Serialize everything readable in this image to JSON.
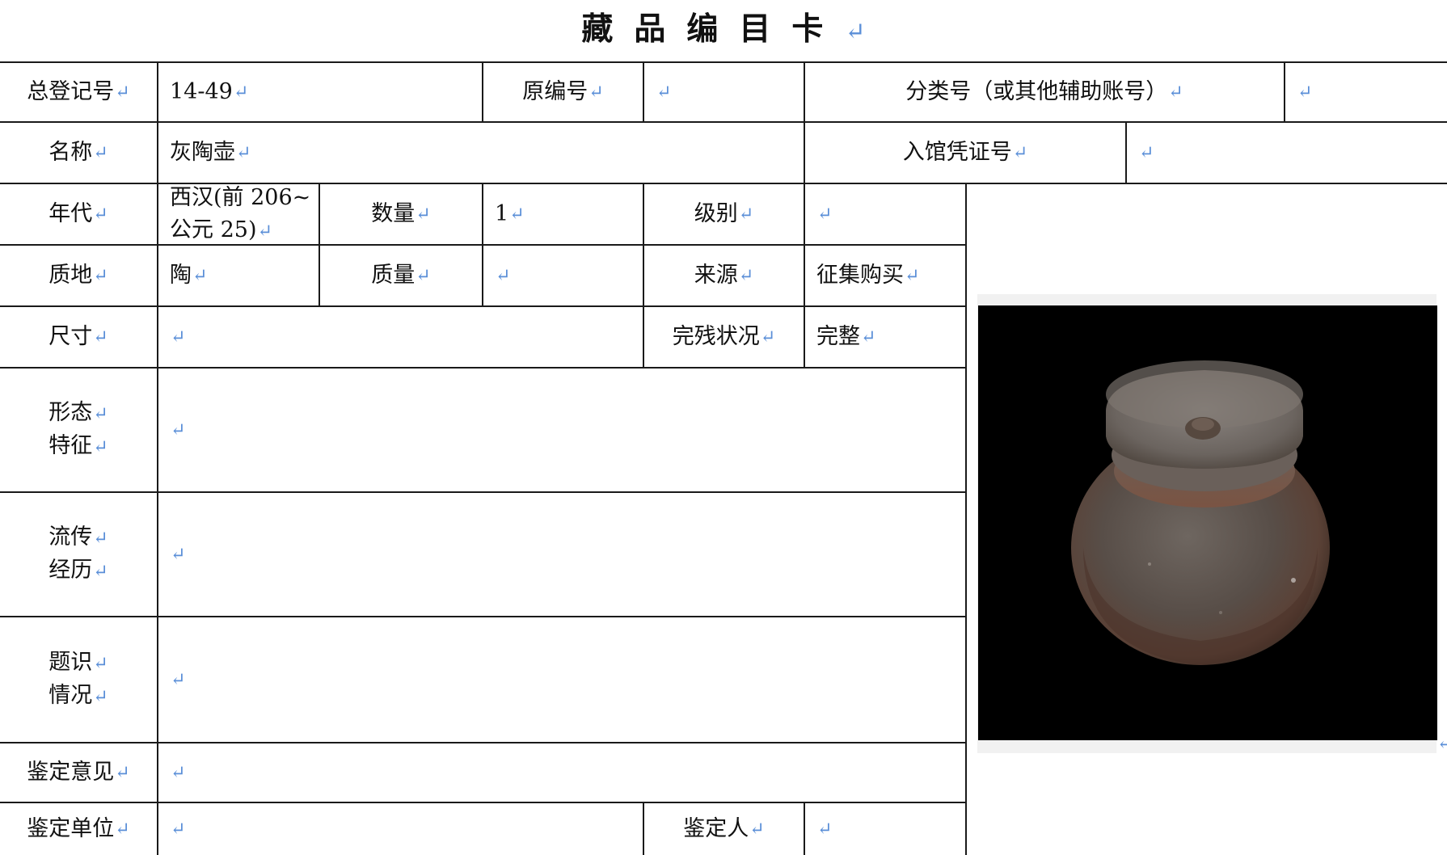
{
  "card": {
    "title": "藏品编目卡",
    "return_mark": "↵"
  },
  "labels": {
    "reg_no": "总登记号",
    "orig_no": "原编号",
    "class_no": "分类号（或其他辅助账号）",
    "name": "名称",
    "voucher_no": "入馆凭证号",
    "era": "年代",
    "quantity": "数量",
    "grade": "级别",
    "material": "质地",
    "mass": "质量",
    "source": "来源",
    "size": "尺寸",
    "condition": "完残状况",
    "form_1": "形态",
    "form_2": "特征",
    "history_1": "流传",
    "history_2": "经历",
    "inscription_1": "题识",
    "inscription_2": "情况",
    "appraisal_opinion": "鉴定意见",
    "appraisal_unit": "鉴定单位",
    "appraiser": "鉴定人"
  },
  "values": {
    "reg_no": "14-49",
    "orig_no": "",
    "class_no": "",
    "name": "灰陶壶",
    "voucher_no": "",
    "era_line1": "西汉(前 206~",
    "era_line2": "公元 25)",
    "quantity": "1",
    "grade": "",
    "material": "陶",
    "mass": "",
    "source": "征集购买",
    "size": "",
    "condition": "完整",
    "form": "",
    "history": "",
    "inscription": "",
    "appraisal_opinion": "",
    "appraisal_unit": "",
    "appraiser": ""
  },
  "colors": {
    "border": "#1a1a1a",
    "return_mark": "#5b8fd8",
    "photo_background": "#000000"
  }
}
